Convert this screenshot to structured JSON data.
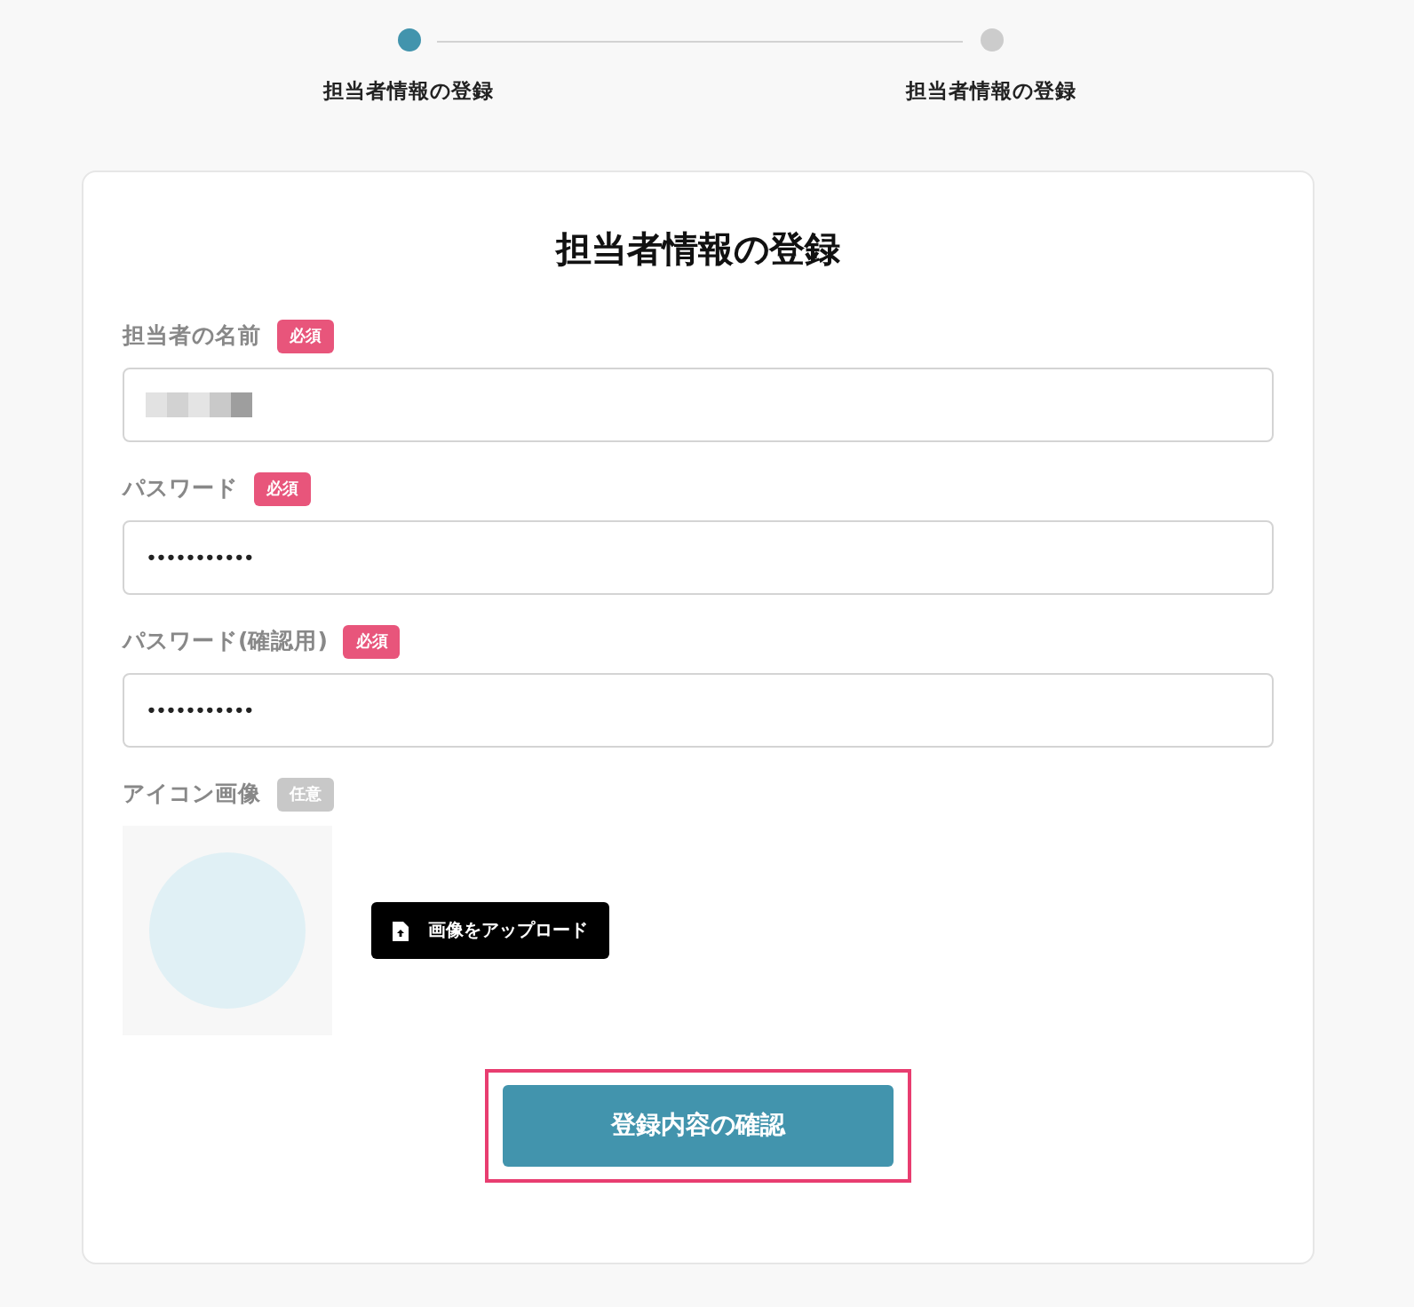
{
  "steps": [
    {
      "label": "担当者情報の登録",
      "selected": true
    },
    {
      "label": "担当者情報の登録",
      "selected": false
    }
  ],
  "form": {
    "title": "担当者情報の登録",
    "fields": [
      {
        "label": "担当者の名前",
        "badge": "必須",
        "kind": "redacted"
      },
      {
        "label": "パスワード",
        "badge": "必須",
        "kind": "text",
        "value": "•••••••••••"
      },
      {
        "label": "パスワード(確認用)",
        "badge": "必須",
        "kind": "text",
        "value": "•••••••••••"
      }
    ],
    "icon_field": {
      "label": "アイコン画像",
      "badge": "任意",
      "upload_button": "画像をアップロード"
    },
    "submit": {
      "label": "登録内容の確認",
      "highlighted": true
    }
  }
}
